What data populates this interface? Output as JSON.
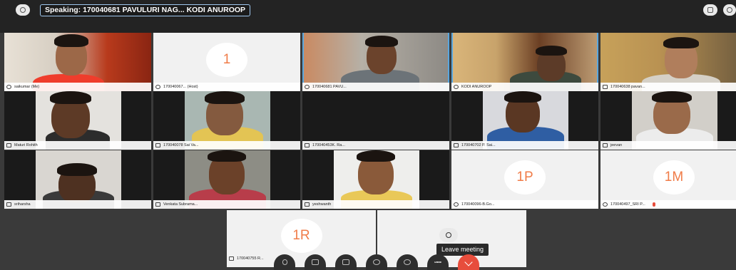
{
  "topbar": {
    "speaking_label": "Speaking: 170040681 PAVULURI NAG...  KODI ANUROOP",
    "left_icon": "info-icon",
    "right_icons": [
      "chat-icon",
      "link-icon"
    ]
  },
  "participants": [
    {
      "name": "saikumar (Me)",
      "type": "video"
    },
    {
      "name": "170040067...  (Host)",
      "type": "avatar",
      "initials": "1"
    },
    {
      "name": "170040681 PAVU...",
      "type": "video"
    },
    {
      "name": "KODI ANUROOP",
      "type": "video"
    },
    {
      "name": "170040638 pavan...",
      "type": "video"
    },
    {
      "name": "Maturi Rohith",
      "type": "video"
    },
    {
      "name": "170040078 Sai Va...",
      "type": "video"
    },
    {
      "name": "170040453K. Ra...",
      "type": "blank"
    },
    {
      "name": "170040702 P. Sai...",
      "type": "video"
    },
    {
      "name": "jeevan",
      "type": "video"
    },
    {
      "name": "sriharsha",
      "type": "video"
    },
    {
      "name": "Venkata Subrama...",
      "type": "video"
    },
    {
      "name": "yeshwanth",
      "type": "video"
    },
    {
      "name": "170040096-B.Go...",
      "type": "avatar",
      "initials": "1P"
    },
    {
      "name": "170040497_SRI P...",
      "type": "avatar",
      "initials": "1M"
    },
    {
      "name": "170040755 R...",
      "type": "avatar",
      "initials": "1R"
    }
  ],
  "controls": {
    "buttons": [
      "mic-icon",
      "video-camera-icon",
      "share-screen-icon",
      "participants-icon",
      "chat-bubble-icon",
      "more-icon",
      "leave-icon"
    ],
    "tooltip": "Leave meeting"
  },
  "colors": {
    "accent": "#5aa7de",
    "avatar_text": "#f07c48",
    "leave": "#e74d3c"
  }
}
